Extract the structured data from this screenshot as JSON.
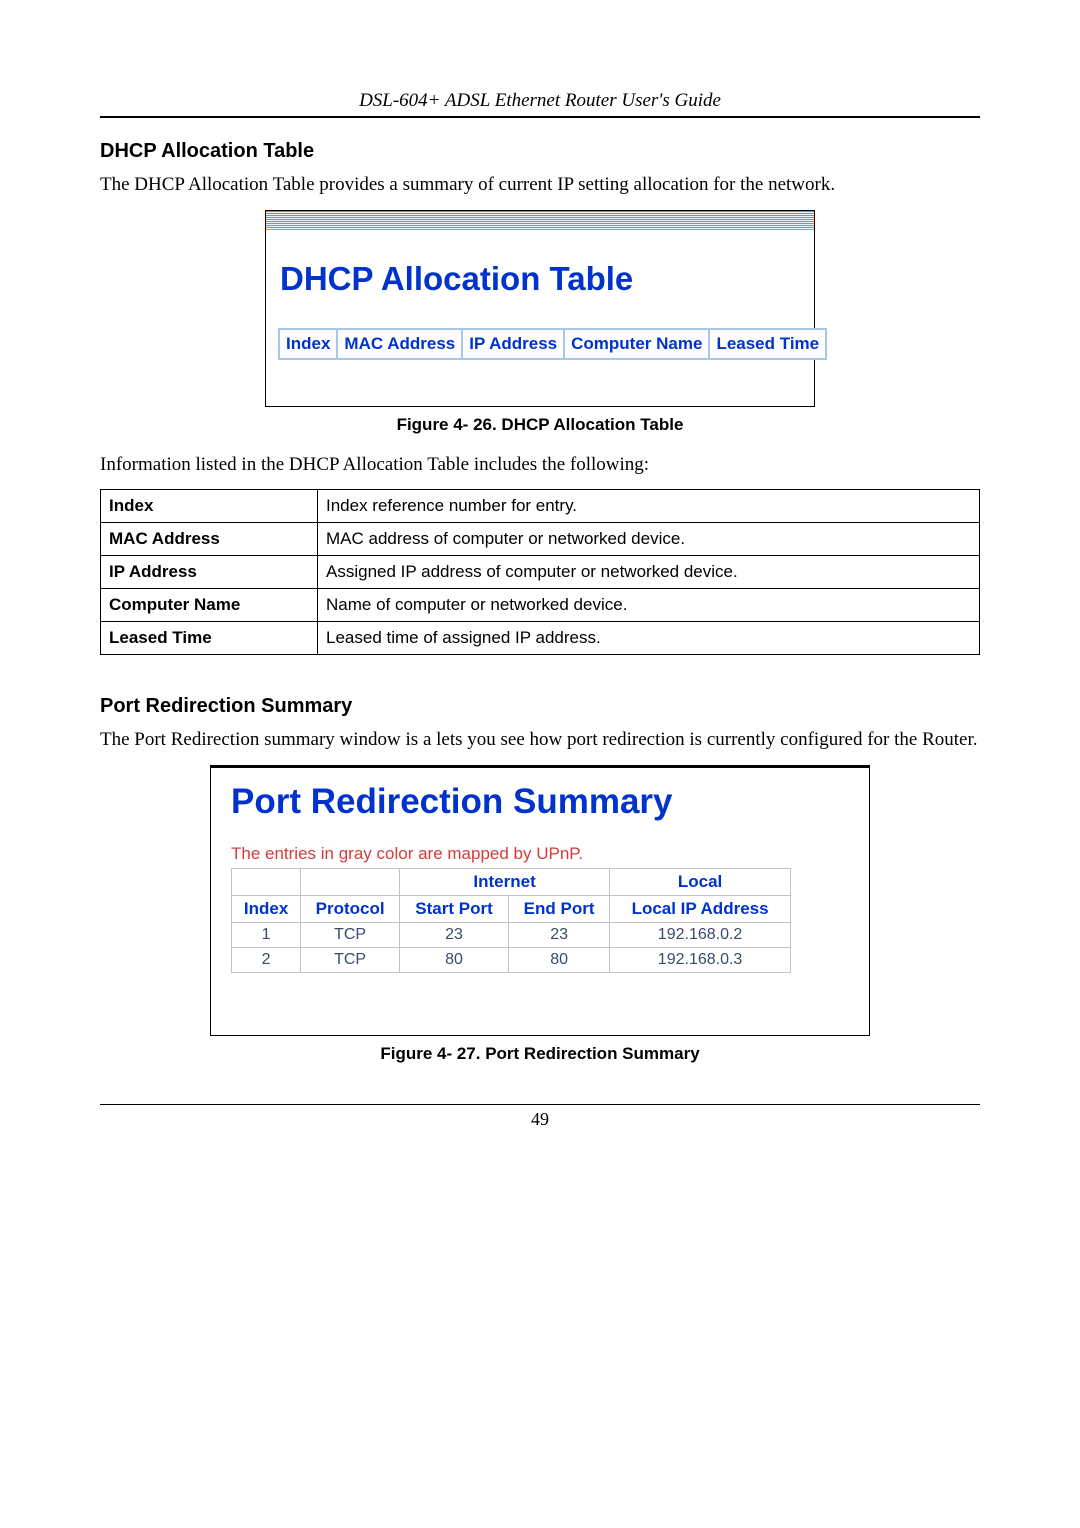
{
  "header": {
    "title": "DSL-604+ ADSL Ethernet Router User's Guide"
  },
  "dhcp": {
    "heading": "DHCP Allocation Table",
    "intro": "The DHCP Allocation Table provides a summary of current IP setting allocation for the network.",
    "screenshot": {
      "title": "DHCP Allocation Table",
      "columns": [
        "Index",
        "MAC Address",
        "IP Address",
        "Computer Name",
        "Leased Time"
      ]
    },
    "caption": "Figure 4- 26. DHCP Allocation Table",
    "info_intro": "Information listed in the DHCP Allocation Table includes the following:",
    "info_table": [
      {
        "label": "Index",
        "desc": "Index reference number for entry."
      },
      {
        "label": "MAC Address",
        "desc": "MAC address of computer or networked device."
      },
      {
        "label": "IP Address",
        "desc": "Assigned IP address of computer or networked device."
      },
      {
        "label": "Computer Name",
        "desc": "Name of computer or networked device."
      },
      {
        "label": "Leased Time",
        "desc": "Leased time of assigned IP address."
      }
    ]
  },
  "port": {
    "heading": "Port Redirection Summary",
    "intro": "The Port Redirection summary window is a lets you see how port redirection is currently configured for the Router.",
    "screenshot": {
      "title": "Port Redirection Summary",
      "note": "The entries in gray color are mapped by UPnP.",
      "group_heads": {
        "internet": "Internet",
        "local": "Local"
      },
      "columns": [
        "Index",
        "Protocol",
        "Start Port",
        "End Port",
        "Local IP Address"
      ],
      "rows": [
        {
          "index": "1",
          "protocol": "TCP",
          "start": "23",
          "end": "23",
          "ip": "192.168.0.2"
        },
        {
          "index": "2",
          "protocol": "TCP",
          "start": "80",
          "end": "80",
          "ip": "192.168.0.3"
        }
      ]
    },
    "caption": "Figure 4- 27. Port Redirection Summary"
  },
  "page_number": "49"
}
